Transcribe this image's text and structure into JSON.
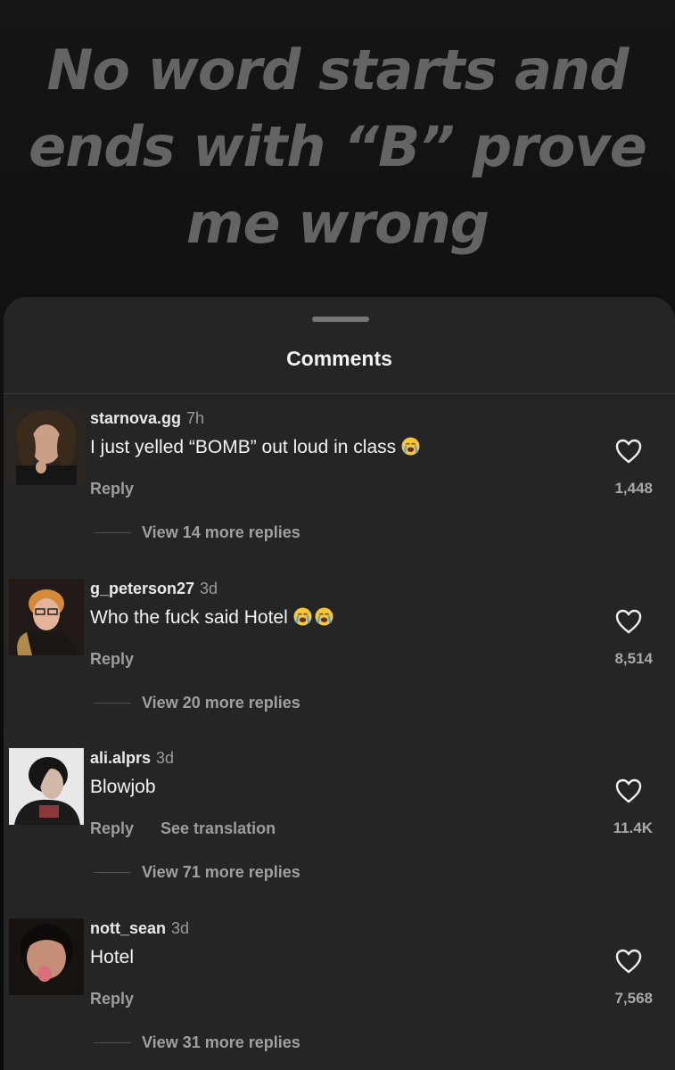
{
  "caption": "No word starts and\nends with “B” prove\nme wrong",
  "sheet": {
    "title": "Comments"
  },
  "icons": {
    "like": "heart-outline-icon",
    "emoji": "loudly-crying-face-emoji"
  },
  "colors": {
    "sheet_background": "#252526",
    "caption_text": "#646464",
    "emoji_face": "#f6c63b",
    "emoji_tears": "#5aa7e6"
  },
  "comments": [
    {
      "username": "starnova.gg",
      "time": "7h",
      "text": "I just yelled “BOMB” out loud in class",
      "emoji_count": 1,
      "reply_label": "Reply",
      "translate_label": "",
      "likes": "1,448",
      "view_replies": "View 14 more replies"
    },
    {
      "username": "g_peterson27",
      "time": "3d",
      "text": "Who the fuck said Hotel",
      "emoji_count": 2,
      "reply_label": "Reply",
      "translate_label": "",
      "likes": "8,514",
      "view_replies": "View 20 more replies"
    },
    {
      "username": "ali.alprs",
      "time": "3d",
      "text": "Blowjob",
      "emoji_count": 0,
      "reply_label": "Reply",
      "translate_label": "See translation",
      "likes": "11.4K",
      "view_replies": "View 71 more replies"
    },
    {
      "username": "nott_sean",
      "time": "3d",
      "text": "Hotel",
      "emoji_count": 0,
      "reply_label": "Reply",
      "translate_label": "",
      "likes": "7,568",
      "view_replies": "View 31 more replies"
    }
  ]
}
